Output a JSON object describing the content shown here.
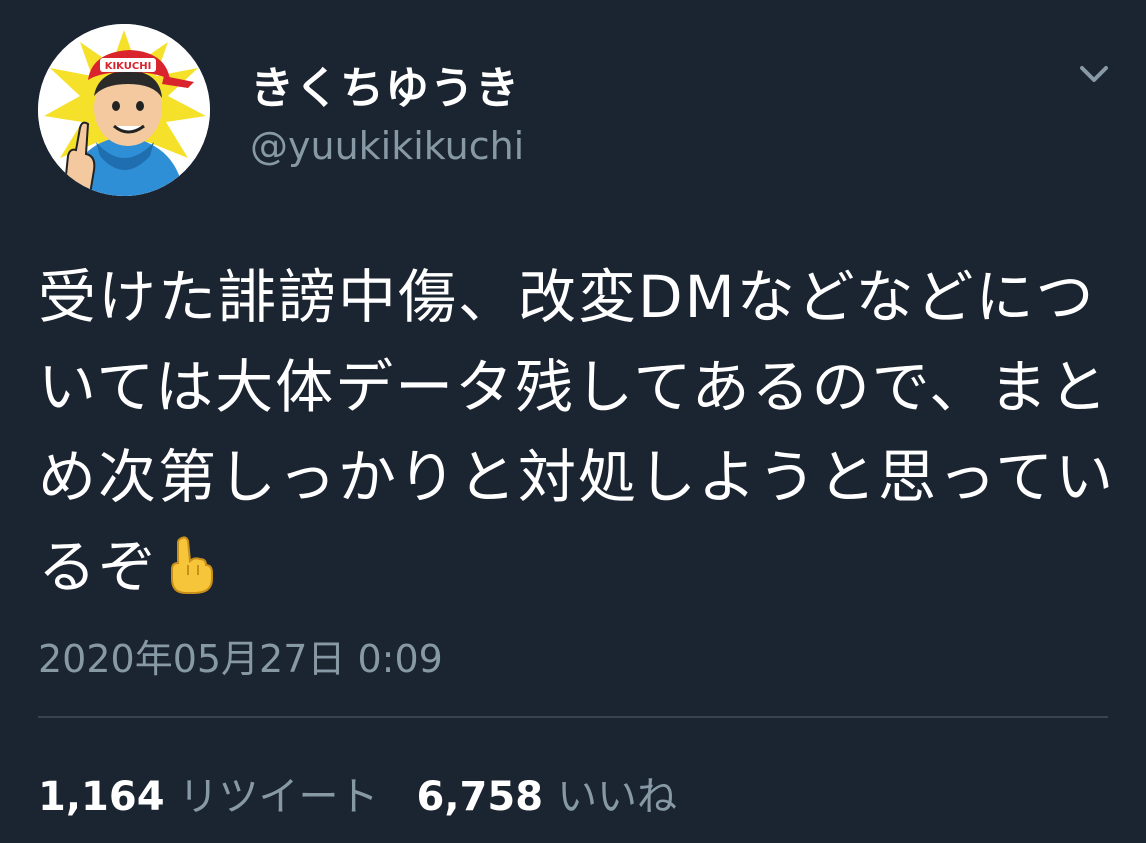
{
  "user": {
    "display_name": "きくちゆうき",
    "handle": "@yuukikikuchi",
    "avatar_icon": "cartoon-avatar-icon",
    "cap_text": "KIKUCHI"
  },
  "menu": {
    "icon": "chevron-down-icon"
  },
  "tweet": {
    "text": "受けた誹謗中傷、改変DMなどなどについては大体データ残してあるので、まとめ次第しっかりと対処しようと思っているぞ",
    "emoji_icon": "pointing-up-hand-icon",
    "timestamp": "2020年05月27日 0:09"
  },
  "stats": {
    "retweets_count": "1,164",
    "retweets_label": "リツイート",
    "likes_count": "6,758",
    "likes_label": "いいね"
  },
  "colors": {
    "background": "#1b2431",
    "text": "#ffffff",
    "secondary": "#8899a6",
    "divider": "#38444d"
  }
}
